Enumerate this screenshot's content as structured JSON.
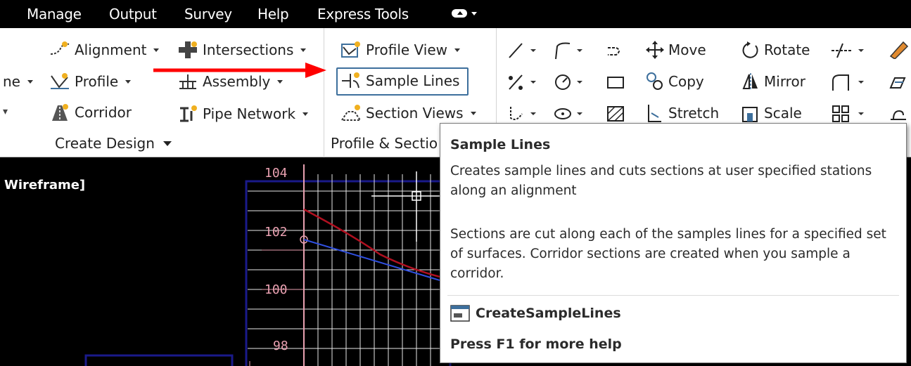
{
  "menubar": {
    "items": [
      "Manage",
      "Output",
      "Survey",
      "Help",
      "Express Tools"
    ]
  },
  "ribbon": {
    "create_design": {
      "partial_left_label": "ne",
      "buttons": {
        "alignment": "Alignment",
        "profile": "Profile",
        "corridor": "Corridor",
        "intersections": "Intersections",
        "assembly": "Assembly",
        "pipe_network": "Pipe Network"
      },
      "panel_title": "Create Design"
    },
    "profile_section": {
      "buttons": {
        "profile_view": "Profile View",
        "sample_lines": "Sample Lines",
        "section_views": "Section Views"
      },
      "panel_title": "Profile & Sectio"
    },
    "modify": {
      "buttons": {
        "move": "Move",
        "copy": "Copy",
        "stretch": "Stretch",
        "rotate": "Rotate",
        "mirror": "Mirror",
        "scale": "Scale"
      }
    }
  },
  "viewport": {
    "label": "Wireframe]",
    "elevation_labels": [
      "104",
      "102",
      "100",
      "98"
    ]
  },
  "tooltip": {
    "title": "Sample Lines",
    "description1": "Creates sample lines and cuts sections at user specified stations along an alignment",
    "description2": "Sections are cut along each of the samples lines for a specified set of surfaces. Corridor sections are created when you sample a corridor.",
    "command": "CreateSampleLines",
    "help": "Press F1 for more help"
  },
  "colors": {
    "menubar_bg": "#000000",
    "highlight_border": "#3d6f9c",
    "annotation_arrow": "#ff0000",
    "grid_pink": "#e8a0b0",
    "frame_blue": "#1a1a8a",
    "profile_red": "#b01020",
    "profile_blue": "#3050e0"
  }
}
